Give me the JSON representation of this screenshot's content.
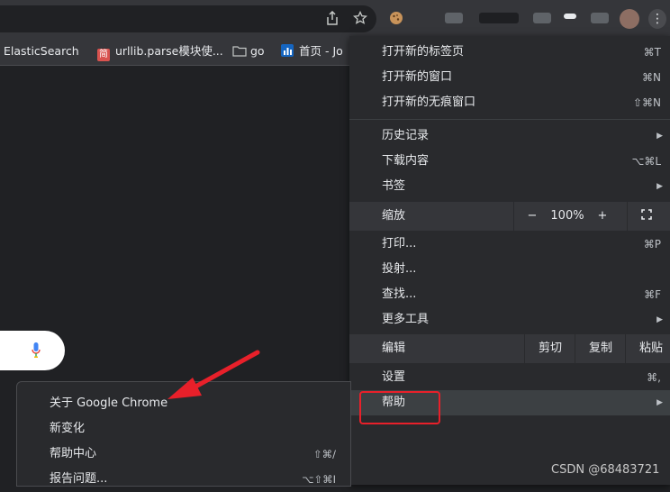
{
  "toolbar": {
    "icons": [
      "share-icon",
      "star-icon",
      "cookie-extension-icon",
      "extension-icon",
      "menu-kebab-icon"
    ]
  },
  "bookmarks": [
    {
      "label": "ElasticSearch",
      "icon": "blank-icon"
    },
    {
      "label": "urllib.parse模块使...",
      "icon": "简",
      "icon_color": "#d9534f"
    },
    {
      "label": "go",
      "icon": "folder-icon"
    },
    {
      "label": "首页 - Jo",
      "icon": "chart-icon",
      "icon_color": "#1e88e5"
    }
  ],
  "menu": {
    "items": [
      {
        "label": "打开新的标签页",
        "shortcut": "⌘T"
      },
      {
        "label": "打开新的窗口",
        "shortcut": "⌘N"
      },
      {
        "label": "打开新的无痕窗口",
        "shortcut": "⇧⌘N"
      },
      {
        "label": "历史记录",
        "arrow": "▶"
      },
      {
        "label": "下载内容",
        "shortcut": "⌥⌘L"
      },
      {
        "label": "书签",
        "arrow": "▶"
      },
      {
        "label": "打印...",
        "shortcut": "⌘P"
      },
      {
        "label": "投射..."
      },
      {
        "label": "查找...",
        "shortcut": "⌘F"
      },
      {
        "label": "更多工具",
        "arrow": "▶"
      },
      {
        "label": "设置",
        "shortcut": "⌘,"
      },
      {
        "label": "帮助",
        "arrow": "▶"
      }
    ],
    "zoom": {
      "label": "缩放",
      "minus": "−",
      "value": "100%",
      "plus": "+",
      "fullscreen": "⛶"
    },
    "edit": {
      "label": "编辑",
      "cut": "剪切",
      "copy": "复制",
      "paste": "粘贴"
    }
  },
  "help_submenu": {
    "items": [
      {
        "label": "关于 Google Chrome"
      },
      {
        "label": "新变化"
      },
      {
        "label": "帮助中心",
        "shortcut": "⇧⌘/"
      },
      {
        "label": "报告问题...",
        "shortcut": "⌥⇧⌘I"
      }
    ]
  },
  "watermark": "CSDN @68483721",
  "colors": {
    "highlight": "#e8202a",
    "arrow": "#e8202a",
    "menu_bg": "#292a2d"
  }
}
